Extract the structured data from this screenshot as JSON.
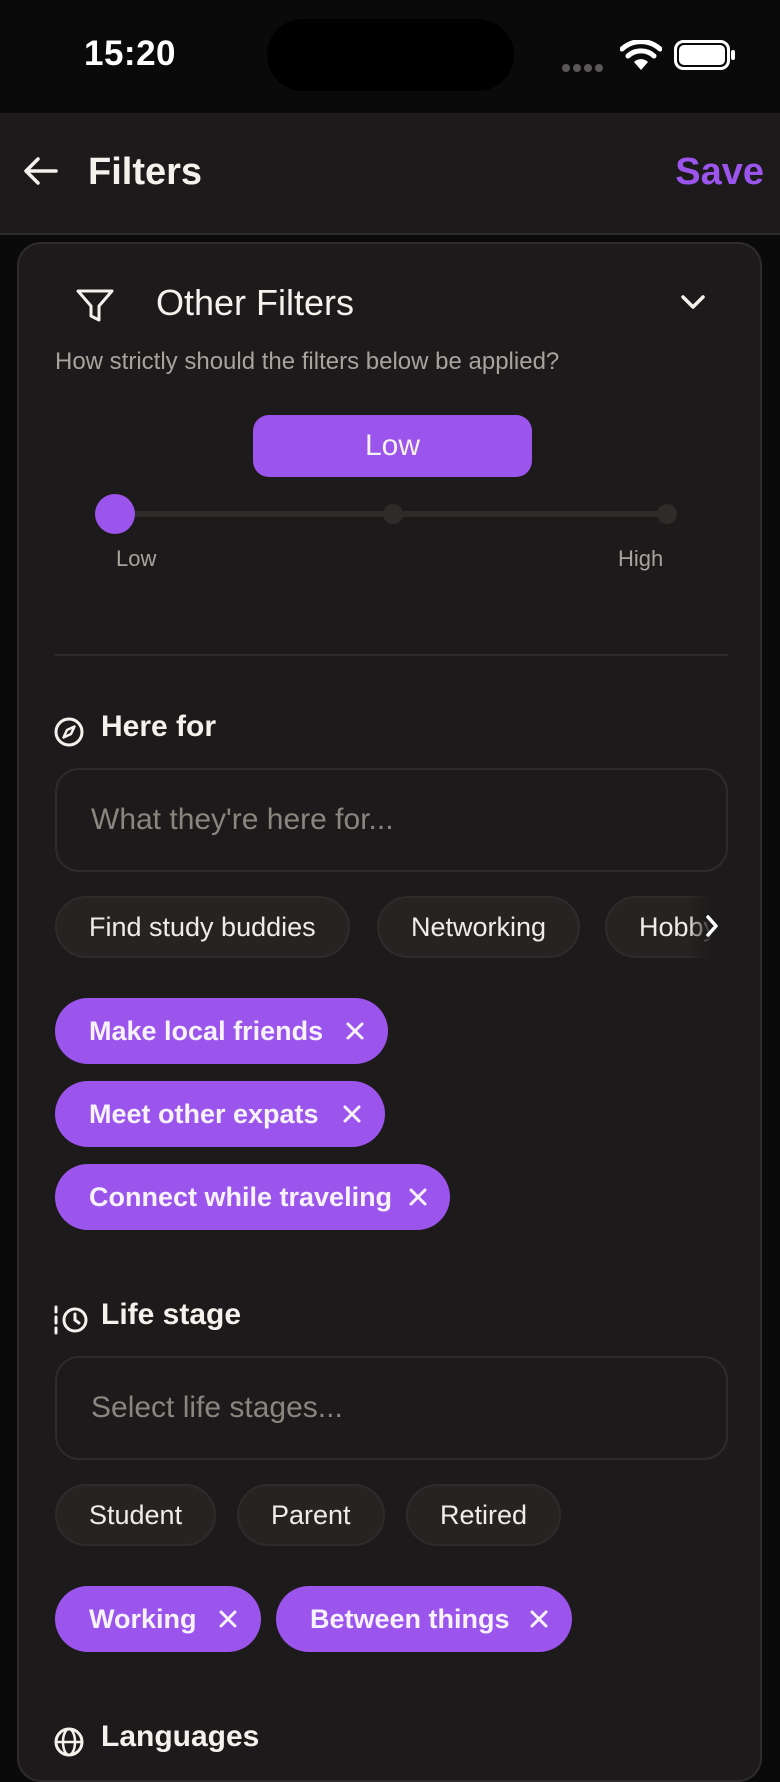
{
  "status_bar": {
    "time": "15:20"
  },
  "header": {
    "title": "Filters",
    "save_label": "Save"
  },
  "other_filters": {
    "title": "Other Filters",
    "subtitle": "How strictly should the filters below be applied?",
    "strictness": {
      "value_label": "Low",
      "min_label": "Low",
      "max_label": "High",
      "level": 0,
      "steps": 3
    }
  },
  "here_for": {
    "label": "Here for",
    "placeholder": "What they're here for...",
    "suggestions": [
      "Find study buddies",
      "Networking",
      "Hobby"
    ],
    "selected": [
      "Make local friends",
      "Meet other expats",
      "Connect while traveling"
    ]
  },
  "life_stage": {
    "label": "Life stage",
    "placeholder": "Select life stages...",
    "suggestions": [
      "Student",
      "Parent",
      "Retired"
    ],
    "selected": [
      "Working",
      "Between things"
    ]
  },
  "languages": {
    "label": "Languages"
  },
  "colors": {
    "accent": "#9b55ec",
    "background": "#1c1a1a"
  }
}
